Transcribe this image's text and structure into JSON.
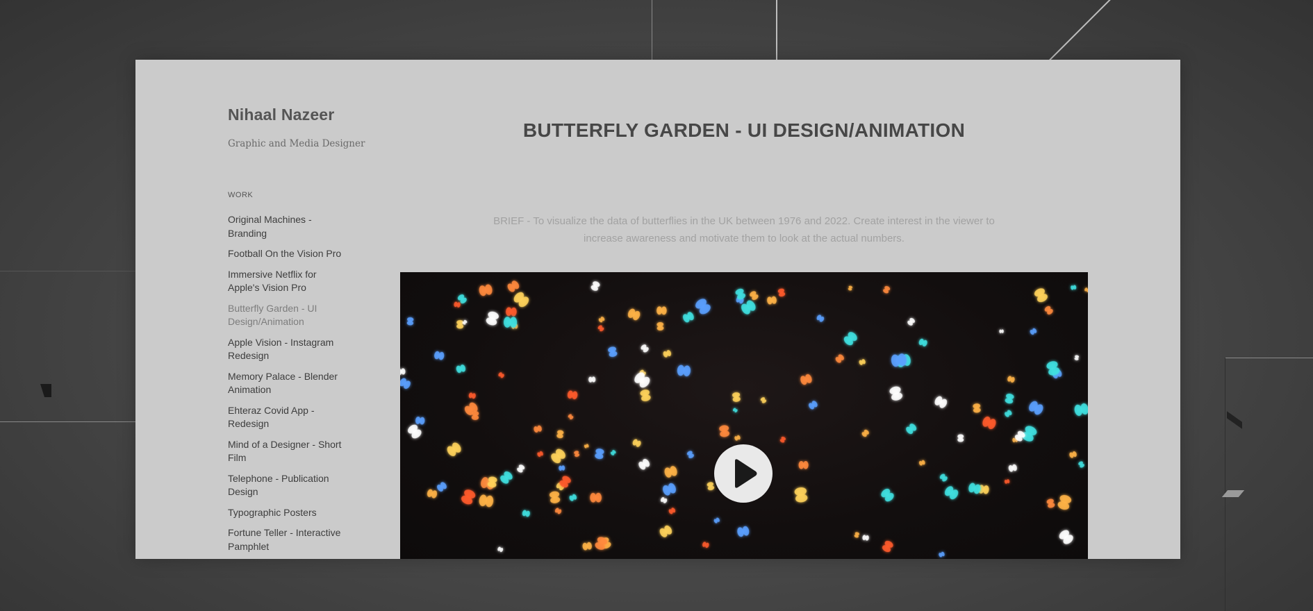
{
  "site": {
    "name": "Nihaal Nazeer",
    "tagline": "Graphic and Media Designer"
  },
  "nav": {
    "section_label": "WORK",
    "items": [
      {
        "label": "Original Machines - Branding",
        "active": false
      },
      {
        "label": "Football On the Vision Pro",
        "active": false
      },
      {
        "label": "Immersive Netflix for Apple's Vision Pro",
        "active": false
      },
      {
        "label": "Butterfly Garden - UI Design/Animation",
        "active": true
      },
      {
        "label": "Apple Vision - Instagram Redesign",
        "active": false
      },
      {
        "label": "Memory Palace - Blender Animation",
        "active": false
      },
      {
        "label": "Ehteraz Covid App - Redesign",
        "active": false
      },
      {
        "label": "Mind of a Designer - Short Film",
        "active": false
      },
      {
        "label": "Telephone - Publication Design",
        "active": false
      },
      {
        "label": "Typographic Posters",
        "active": false
      },
      {
        "label": "Fortune Teller - Interactive Pamphlet",
        "active": false
      }
    ]
  },
  "page": {
    "title": "BUTTERFLY GARDEN - UI DESIGN/ANIMATION",
    "brief": "BRIEF - To visualize the data of butterflies in the UK between 1976 and 2022. Create interest in the viewer to increase awareness and motivate them to look at the actual numbers."
  },
  "video": {
    "play_icon": "play-icon",
    "glow_colors": [
      "#ff8a3d",
      "#ffb347",
      "#ff5a2a",
      "#5aa0ff",
      "#3fe0e0",
      "#ffffff",
      "#ffd25a"
    ]
  }
}
